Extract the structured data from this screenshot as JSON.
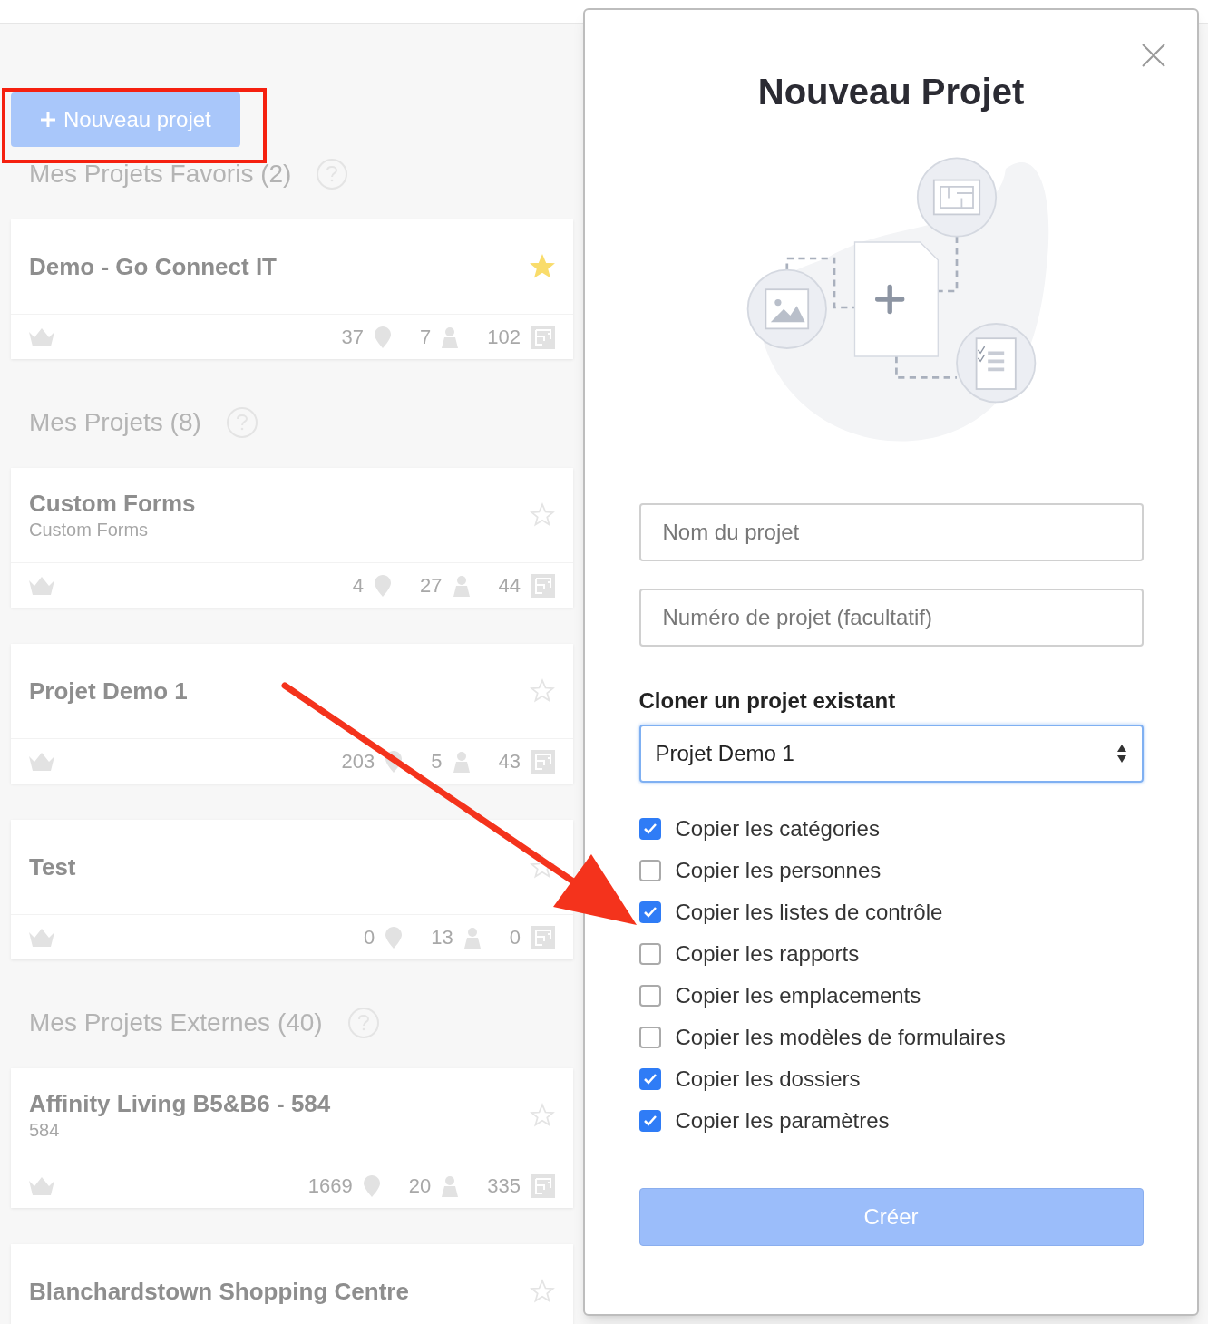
{
  "new_project_button": {
    "label": "Nouveau projet"
  },
  "sections": [
    {
      "title": "Mes Projets Favoris (2)",
      "projects": [
        {
          "name": "Demo - Go Connect IT",
          "favorite": true,
          "stats": [
            "37",
            "7",
            "102"
          ]
        }
      ]
    },
    {
      "title": "Mes Projets (8)",
      "projects": [
        {
          "name": "Custom Forms",
          "subtitle": "Custom Forms",
          "favorite": false,
          "stats": [
            "4",
            "27",
            "44"
          ]
        },
        {
          "name": "Projet Demo 1",
          "favorite": false,
          "stats": [
            "203",
            "5",
            "43"
          ]
        },
        {
          "name": "Test",
          "favorite": false,
          "stats": [
            "0",
            "13",
            "0"
          ]
        }
      ]
    },
    {
      "title": "Mes Projets Externes (40)",
      "projects": [
        {
          "name": "Affinity Living B5&B6 - 584",
          "subtitle": "584",
          "favorite": false,
          "stats": [
            "1669",
            "20",
            "335"
          ]
        },
        {
          "name": "Blanchardstown Shopping Centre",
          "favorite": false
        }
      ]
    }
  ],
  "modal": {
    "title": "Nouveau Projet",
    "fields": [
      {
        "placeholder": "Nom du projet"
      },
      {
        "placeholder": "Numéro de projet (facultatif)"
      }
    ],
    "clone_label": "Cloner un projet existant",
    "clone_select": {
      "value": "Projet Demo 1"
    },
    "options": [
      {
        "label": "Copier les catégories",
        "checked": true
      },
      {
        "label": "Copier les personnes",
        "checked": false
      },
      {
        "label": "Copier les listes de contrôle",
        "checked": true
      },
      {
        "label": "Copier les rapports",
        "checked": false
      },
      {
        "label": "Copier les emplacements",
        "checked": false
      },
      {
        "label": "Copier les modèles de formulaires",
        "checked": false
      },
      {
        "label": "Copier les dossiers",
        "checked": true
      },
      {
        "label": "Copier les paramètres",
        "checked": true
      }
    ],
    "submit": {
      "label": "Créer"
    }
  }
}
